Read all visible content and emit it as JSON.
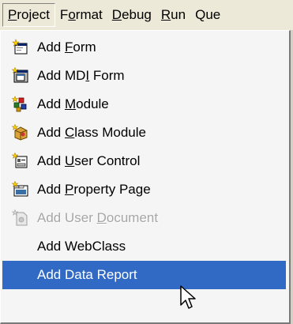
{
  "menubar": {
    "items": [
      {
        "prefix": "",
        "accel": "P",
        "suffix": "roject"
      },
      {
        "prefix": "F",
        "accel": "o",
        "suffix": "rmat"
      },
      {
        "prefix": "",
        "accel": "D",
        "suffix": "ebug"
      },
      {
        "prefix": "",
        "accel": "R",
        "suffix": "un"
      },
      {
        "prefix": "Qu",
        "accel": "",
        "suffix": "e"
      }
    ]
  },
  "menu": {
    "items": [
      {
        "prefix": "Add ",
        "accel": "F",
        "suffix": "orm",
        "icon": "form-icon"
      },
      {
        "prefix": "Add MD",
        "accel": "I",
        "suffix": " Form",
        "icon": "mdi-form-icon"
      },
      {
        "prefix": "Add ",
        "accel": "M",
        "suffix": "odule",
        "icon": "module-icon"
      },
      {
        "prefix": "Add ",
        "accel": "C",
        "suffix": "lass Module",
        "icon": "class-module-icon"
      },
      {
        "prefix": "Add ",
        "accel": "U",
        "suffix": "ser Control",
        "icon": "user-control-icon"
      },
      {
        "prefix": "Add ",
        "accel": "P",
        "suffix": "roperty Page",
        "icon": "property-page-icon"
      },
      {
        "prefix": "Add User ",
        "accel": "D",
        "suffix": "ocument",
        "icon": "user-document-icon",
        "state": "disabled"
      },
      {
        "prefix": "Add WebClass",
        "accel": "",
        "suffix": ""
      },
      {
        "prefix": "Add Data Report",
        "accel": "",
        "suffix": "",
        "state": "selected"
      }
    ]
  },
  "colors": {
    "selection": "#316ac5",
    "disabled_text": "#a6a6a6",
    "menu_background": "#f5f5f5"
  }
}
